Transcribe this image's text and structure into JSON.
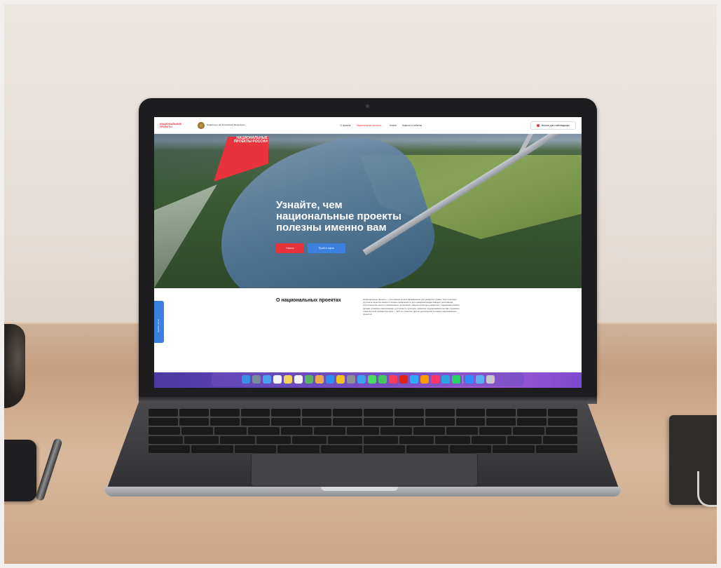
{
  "site": {
    "logo_national_projects": "НАЦИОНАЛЬНЫЕ ПРОЕКТЫ",
    "gov_logo_text": "Правительство Российской Федерации",
    "nav": [
      {
        "label": "О проекте"
      },
      {
        "label": "Национальные проекты ⌄"
      },
      {
        "label": "Успехи"
      },
      {
        "label": "Новости и события"
      }
    ],
    "help_button": "Версия для слабовидящих",
    "hero": {
      "badge": "НАЦИОНАЛЬНЫЕ ПРОЕКТЫ РОССИИ",
      "title": "Узнайте, чем национальные проекты полезны именно вам",
      "primary_button": "Начать",
      "secondary_button": "Пройти опрос"
    },
    "about": {
      "title": "О национальных проектах",
      "text": "Национальные проекты — это приоритетные направления для развития страны. Они помогают улучшить качество жизни и создать возможности для самореализации каждого россиянина. Строительство школ и современных поликлиник, защита природы и животных, поддержка семей с детьми и помощь пенсионерам, доступность культуры, развитие предпринимательства и дорожно-транспортной инфраструктуры — всё это и многое другое реализуется в рамках национальных проектов."
    },
    "side_tab": "Пройти опрос"
  },
  "dock": {
    "icons": [
      "finder-icon",
      "launchpad-icon",
      "mail-icon",
      "calendar-icon",
      "notes-icon",
      "reminders-icon",
      "maps-icon",
      "photos-icon",
      "appstore-icon",
      "chrome-icon",
      "settings-icon",
      "safari-icon",
      "messages-icon",
      "facetime-icon",
      "music-icon",
      "acrobat-icon",
      "photoshop-icon",
      "illustrator-icon",
      "indesign-icon",
      "telegram-icon",
      "whatsapp-icon",
      "zoom-icon",
      "folder-icon",
      "trash-icon"
    ],
    "colors": [
      "#3a8ee6",
      "#7a8a9a",
      "#4aa0f0",
      "#f4f4f4",
      "#f2d35a",
      "#f3f3f3",
      "#58b368",
      "#e9a84f",
      "#2f8cf0",
      "#f0c020",
      "#8f8f94",
      "#3aa2ee",
      "#4cd964",
      "#45c760",
      "#fa3d5b",
      "#e2231a",
      "#31a8ff",
      "#ff9a00",
      "#ff3366",
      "#2aa3e0",
      "#25d366",
      "#2d8cff",
      "#5ab0f0",
      "#c8c8cc"
    ]
  }
}
